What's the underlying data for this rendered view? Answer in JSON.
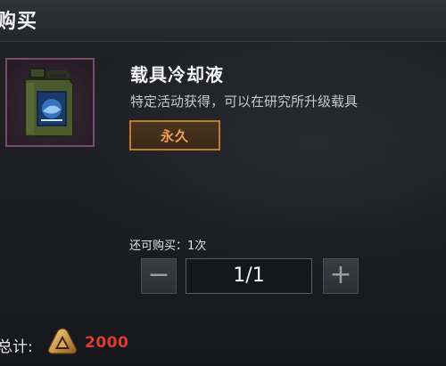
{
  "header": {
    "title": "购买"
  },
  "item": {
    "icon": "coolant-canister-icon",
    "name": "载具冷却液",
    "description": "特定活动获得，可以在研究所升级载具",
    "duration": "永久"
  },
  "purchase": {
    "remaining_label": "还可购买：1次",
    "minus_label": "−",
    "plus_label": "+",
    "quantity": "1/1"
  },
  "footer": {
    "total_label": "总计:",
    "currency_icon": "triangle-coin-icon",
    "total_value": "2000"
  },
  "colors": {
    "badge_border": "#c07a2e",
    "badge_text": "#f0a050",
    "price": "#e23a2e",
    "item_frame": "#7a4a6e"
  }
}
